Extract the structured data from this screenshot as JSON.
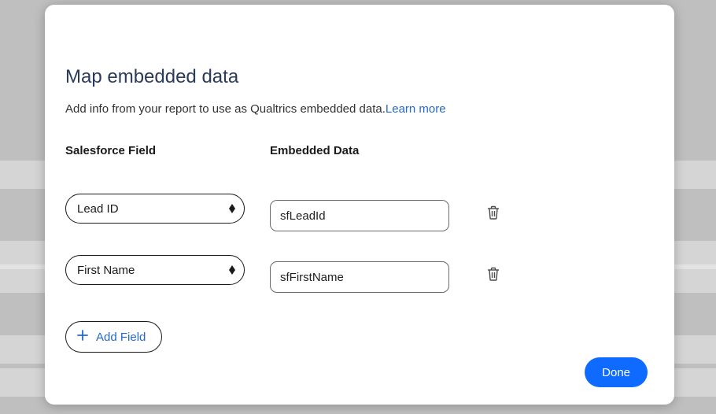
{
  "modal": {
    "title": "Map embedded data",
    "description_prefix": "Add info from your report to use as Qualtrics embedded data.",
    "learn_more_label": "Learn more"
  },
  "columns": {
    "left": "Salesforce Field",
    "right": "Embedded Data"
  },
  "rows": [
    {
      "salesforce_field": "Lead ID",
      "embedded_value": "sfLeadId"
    },
    {
      "salesforce_field": "First Name",
      "embedded_value": "sfFirstName"
    }
  ],
  "buttons": {
    "add_field": "Add Field",
    "done": "Done"
  }
}
